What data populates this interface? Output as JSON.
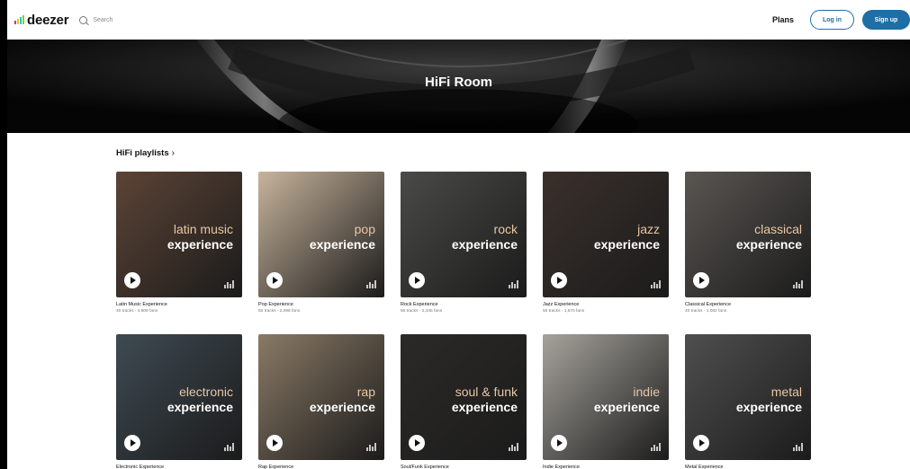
{
  "header": {
    "logo_text": "deezer",
    "search_placeholder": "Search",
    "plans_label": "Plans",
    "login_label": "Log in",
    "signup_label": "Sign up",
    "logo_colors": [
      "#ff0092",
      "#ffc000",
      "#00c7f2",
      "#7ed321",
      "#ff7a00"
    ],
    "accent_color": "#1d6fa5"
  },
  "hero": {
    "title": "HiFi Room"
  },
  "section": {
    "title": "HiFi playlists",
    "chevron": "›"
  },
  "playlists": [
    {
      "genre": "latin music",
      "overlay": "experience",
      "title": "Latin Music Experience",
      "meta": "40 tracks - 4,809 fans",
      "bg": "#5c4436"
    },
    {
      "genre": "pop",
      "overlay": "experience",
      "title": "Pop Experience",
      "meta": "50 tracks - 2,098 fans",
      "bg": "#c7b49c"
    },
    {
      "genre": "rock",
      "overlay": "experience",
      "title": "Rock Experience",
      "meta": "50 tracks - 2,345 fans",
      "bg": "#4a4a48"
    },
    {
      "genre": "jazz",
      "overlay": "experience",
      "title": "Jazz Experience",
      "meta": "50 tracks - 1,670 fans",
      "bg": "#3a302c"
    },
    {
      "genre": "classical",
      "overlay": "experience",
      "title": "Classical Experience",
      "meta": "40 tracks - 1,082 fans",
      "bg": "#5a5652"
    },
    {
      "genre": "electronic",
      "overlay": "experience",
      "title": "Electronic Experience",
      "meta": "",
      "bg": "#3e4a52"
    },
    {
      "genre": "rap",
      "overlay": "experience",
      "title": "Rap Experience",
      "meta": "",
      "bg": "#8a7a66"
    },
    {
      "genre": "soul & funk",
      "overlay": "experience",
      "title": "Soul/Funk Experience",
      "meta": "",
      "bg": "#2c2a28"
    },
    {
      "genre": "indie",
      "overlay": "experience",
      "title": "Indie Experience",
      "meta": "",
      "bg": "#a6a39c"
    },
    {
      "genre": "metal",
      "overlay": "experience",
      "title": "Metal Experience",
      "meta": "",
      "bg": "#4f4f4f"
    }
  ]
}
